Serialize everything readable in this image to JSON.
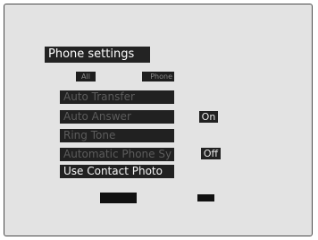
{
  "header": {
    "title": "Phone settings"
  },
  "tabs": [
    {
      "label": "All"
    },
    {
      "label": "Phone"
    }
  ],
  "menu": {
    "items": [
      {
        "label": "Auto Transfer"
      },
      {
        "label": "Auto Answer",
        "value": "On"
      },
      {
        "label": "Ring Tone"
      },
      {
        "label": "Automatic Phone Sy",
        "value": "Off"
      },
      {
        "label": "Use Contact Photo",
        "selected": true
      }
    ]
  },
  "softkeys": [
    {
      "label": ""
    },
    {
      "label": ""
    }
  ],
  "colors": {
    "screen_background": "#e3e3e3",
    "item_background": "#212121",
    "dim_text": "#5c5c5c",
    "selected_text": "#f4f4f4"
  }
}
